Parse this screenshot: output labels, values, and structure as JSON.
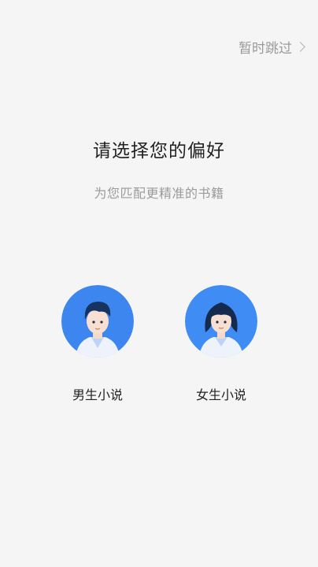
{
  "header": {
    "skip_label": "暂时跳过"
  },
  "main": {
    "title": "请选择您的偏好",
    "subtitle": "为您匹配更精准的书籍",
    "options": [
      {
        "label": "男生小说",
        "icon": "male-avatar-icon",
        "color": "#3f8cf5"
      },
      {
        "label": "女生小说",
        "icon": "female-avatar-icon",
        "color": "#3f8cf5"
      }
    ]
  }
}
